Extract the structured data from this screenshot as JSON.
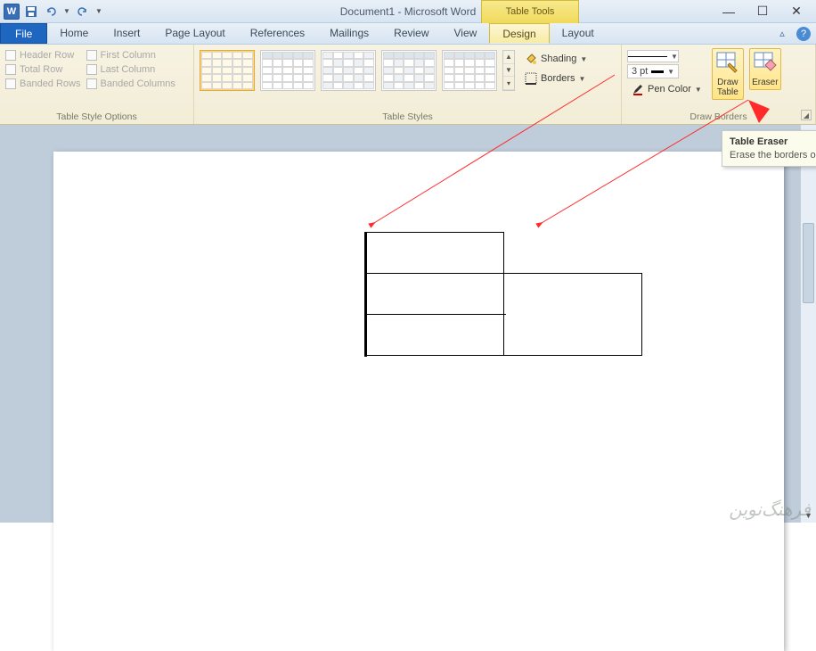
{
  "title": "Document1 - Microsoft Word",
  "context_tab": "Table Tools",
  "qat": {
    "save": "save",
    "undo": "undo",
    "redo": "redo"
  },
  "win": {
    "min": "—",
    "max": "☐",
    "close": "✕"
  },
  "tabs": {
    "file": "File",
    "home": "Home",
    "insert": "Insert",
    "page_layout": "Page Layout",
    "references": "References",
    "mailings": "Mailings",
    "review": "Review",
    "view": "View",
    "design": "Design",
    "layout": "Layout"
  },
  "tso": {
    "group": "Table Style Options",
    "header_row": "Header Row",
    "total_row": "Total Row",
    "banded_rows": "Banded Rows",
    "first_col": "First Column",
    "last_col": "Last Column",
    "banded_cols": "Banded Columns"
  },
  "styles": {
    "group": "Table Styles",
    "shading": "Shading",
    "borders": "Borders"
  },
  "draw": {
    "group": "Draw Borders",
    "weight": "3 pt",
    "pen_color": "Pen Color",
    "draw_table": "Draw\nTable",
    "eraser": "Eraser"
  },
  "tooltip": {
    "title": "Table Eraser",
    "body": "Erase the borders o"
  },
  "help": "?",
  "watermark": "فرهنگ‌نوین"
}
